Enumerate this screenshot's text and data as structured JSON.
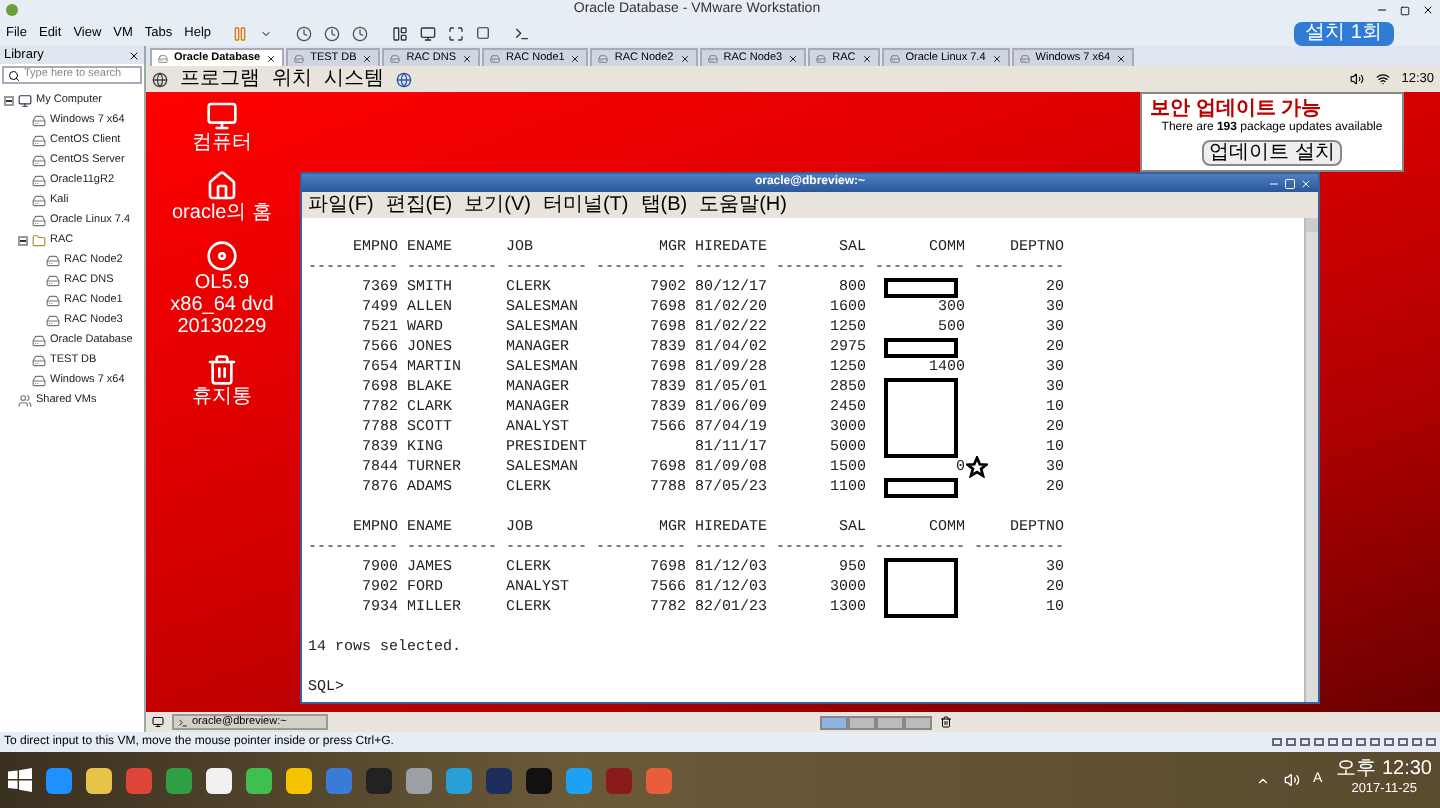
{
  "window": {
    "title": "Oracle Database - VMware Workstation"
  },
  "menu": [
    "File",
    "Edit",
    "View",
    "VM",
    "Tabs",
    "Help"
  ],
  "promo_button": "설치 1회",
  "library": {
    "title": "Library",
    "search": {
      "placeholder": "Type here to search"
    },
    "tree": [
      {
        "kind": "computer",
        "label": "My Computer",
        "expanded": true,
        "children": [
          {
            "kind": "vm",
            "label": "Windows 7 x64"
          },
          {
            "kind": "vm",
            "label": "CentOS Client"
          },
          {
            "kind": "vm",
            "label": "CentOS Server"
          },
          {
            "kind": "vm",
            "label": "Oracle11gR2"
          },
          {
            "kind": "vm",
            "label": "Kali"
          },
          {
            "kind": "vm",
            "label": "Oracle Linux 7.4"
          },
          {
            "kind": "folder",
            "label": "RAC",
            "expanded": true,
            "children": [
              {
                "kind": "vm",
                "label": "RAC Node2"
              },
              {
                "kind": "vm",
                "label": "RAC DNS"
              },
              {
                "kind": "vm",
                "label": "RAC Node1"
              },
              {
                "kind": "vm",
                "label": "RAC Node3"
              }
            ]
          },
          {
            "kind": "vm",
            "label": "Oracle Database"
          },
          {
            "kind": "vm",
            "label": "TEST DB"
          },
          {
            "kind": "vm",
            "label": "Windows 7 x64"
          }
        ]
      },
      {
        "kind": "shared",
        "label": "Shared VMs"
      }
    ]
  },
  "tabs": [
    {
      "label": "Oracle Database",
      "selected": true
    },
    {
      "label": "TEST DB",
      "selected": false
    },
    {
      "label": "RAC DNS",
      "selected": false
    },
    {
      "label": "RAC Node1",
      "selected": false
    },
    {
      "label": "RAC Node2",
      "selected": false
    },
    {
      "label": "RAC Node3",
      "selected": false
    },
    {
      "label": "RAC",
      "selected": false
    },
    {
      "label": "Oracle Linux 7.4",
      "selected": false
    },
    {
      "label": "Windows 7 x64",
      "selected": false
    }
  ],
  "guest": {
    "panel_menu": [
      "프로그램",
      "위치",
      "시스템"
    ],
    "clock": "12:30",
    "desktop_icons": [
      {
        "kind": "computer",
        "label": "컴퓨터"
      },
      {
        "kind": "home",
        "label": "oracle의 홈"
      },
      {
        "kind": "disc",
        "label": "OL5.9 x86_64 dvd 20130229"
      },
      {
        "kind": "trash",
        "label": "휴지통"
      }
    ],
    "notification": {
      "title": "보안 업데이트 가능",
      "message": "There are **193** package updates available",
      "button": "업데이트 설치"
    },
    "terminal": {
      "title": "oracle@dbreview:~",
      "menu": [
        "파일(F)",
        "편집(E)",
        "보기(V)",
        "터미널(T)",
        "탭(B)",
        "도움말(H)"
      ],
      "blocks": [
        {
          "columns": [
            "EMPNO",
            "ENAME",
            "JOB",
            "MGR",
            "HIREDATE",
            "SAL",
            "COMM",
            "DEPTNO"
          ],
          "dashes": [
            "----------",
            "----------",
            "---------",
            "----------",
            "--------",
            "----------",
            "----------",
            "----------"
          ],
          "rows": [
            {
              "empno": "7369",
              "ename": "SMITH",
              "job": "CLERK",
              "mgr": "7902",
              "hiredate": "80/12/17",
              "sal": "800",
              "deptno": "20",
              "marked": true,
              "starred": false
            },
            {
              "empno": "7499",
              "ename": "ALLEN",
              "job": "SALESMAN",
              "mgr": "7698",
              "hiredate": "81/02/20",
              "sal": "1600",
              "comm": "300",
              "deptno": "30",
              "marked": false,
              "starred": false
            },
            {
              "empno": "7521",
              "ename": "WARD",
              "job": "SALESMAN",
              "mgr": "7698",
              "hiredate": "81/02/22",
              "sal": "1250",
              "comm": "500",
              "deptno": "30",
              "marked": false,
              "starred": false
            },
            {
              "empno": "7566",
              "ename": "JONES",
              "job": "MANAGER",
              "mgr": "7839",
              "hiredate": "81/04/02",
              "sal": "2975",
              "deptno": "20",
              "marked": true,
              "starred": false
            },
            {
              "empno": "7654",
              "ename": "MARTIN",
              "job": "SALESMAN",
              "mgr": "7698",
              "hiredate": "81/09/28",
              "sal": "1250",
              "comm": "1400",
              "deptno": "30",
              "marked": false,
              "starred": false
            },
            {
              "empno": "7698",
              "ename": "BLAKE",
              "job": "MANAGER",
              "mgr": "7839",
              "hiredate": "81/05/01",
              "sal": "2850",
              "deptno": "30",
              "marked": true,
              "starred": false
            },
            {
              "empno": "7782",
              "ename": "CLARK",
              "job": "MANAGER",
              "mgr": "7839",
              "hiredate": "81/06/09",
              "sal": "2450",
              "deptno": "10",
              "marked": true,
              "starred": false
            },
            {
              "empno": "7788",
              "ename": "SCOTT",
              "job": "ANALYST",
              "mgr": "7566",
              "hiredate": "87/04/19",
              "sal": "3000",
              "deptno": "20",
              "marked": true,
              "starred": false
            },
            {
              "empno": "7839",
              "ename": "KING",
              "job": "PRESIDENT",
              "hiredate": "81/11/17",
              "sal": "5000",
              "deptno": "10",
              "marked": true,
              "starred": false
            },
            {
              "empno": "7844",
              "ename": "TURNER",
              "job": "SALESMAN",
              "mgr": "7698",
              "hiredate": "81/09/08",
              "sal": "1500",
              "comm": "0",
              "deptno": "30",
              "marked": false,
              "starred": true
            },
            {
              "empno": "7876",
              "ename": "ADAMS",
              "job": "CLERK",
              "mgr": "7788",
              "hiredate": "87/05/23",
              "sal": "1100",
              "deptno": "20",
              "marked": true,
              "starred": false
            }
          ]
        },
        {
          "columns": [
            "EMPNO",
            "ENAME",
            "JOB",
            "MGR",
            "HIREDATE",
            "SAL",
            "COMM",
            "DEPTNO"
          ],
          "dashes": [
            "----------",
            "----------",
            "---------",
            "----------",
            "--------",
            "----------",
            "----------",
            "----------"
          ],
          "rows": [
            {
              "empno": "7900",
              "ename": "JAMES",
              "job": "CLERK",
              "mgr": "7698",
              "hiredate": "81/12/03",
              "sal": "950",
              "deptno": "30",
              "marked": true,
              "starred": false
            },
            {
              "empno": "7902",
              "ename": "FORD",
              "job": "ANALYST",
              "mgr": "7566",
              "hiredate": "81/12/03",
              "sal": "3000",
              "deptno": "20",
              "marked": true,
              "starred": false
            },
            {
              "empno": "7934",
              "ename": "MILLER",
              "job": "CLERK",
              "mgr": "7782",
              "hiredate": "82/01/23",
              "sal": "1300",
              "deptno": "10",
              "marked": true,
              "starred": false
            }
          ]
        }
      ],
      "summary": "14 rows selected.",
      "prompt": "SQL>"
    },
    "taskbar": [
      {
        "label": "oracle@dbreview:~"
      }
    ],
    "workspaces": [
      {
        "selected": true
      },
      {
        "selected": false
      },
      {
        "selected": false
      },
      {
        "selected": false
      }
    ]
  },
  "status_bar": "To direct input to this VM, move the mouse pointer inside or press Ctrl+G.",
  "tray": {
    "ime": "A",
    "time": "오후 12:30",
    "date": "2017-11-25"
  }
}
